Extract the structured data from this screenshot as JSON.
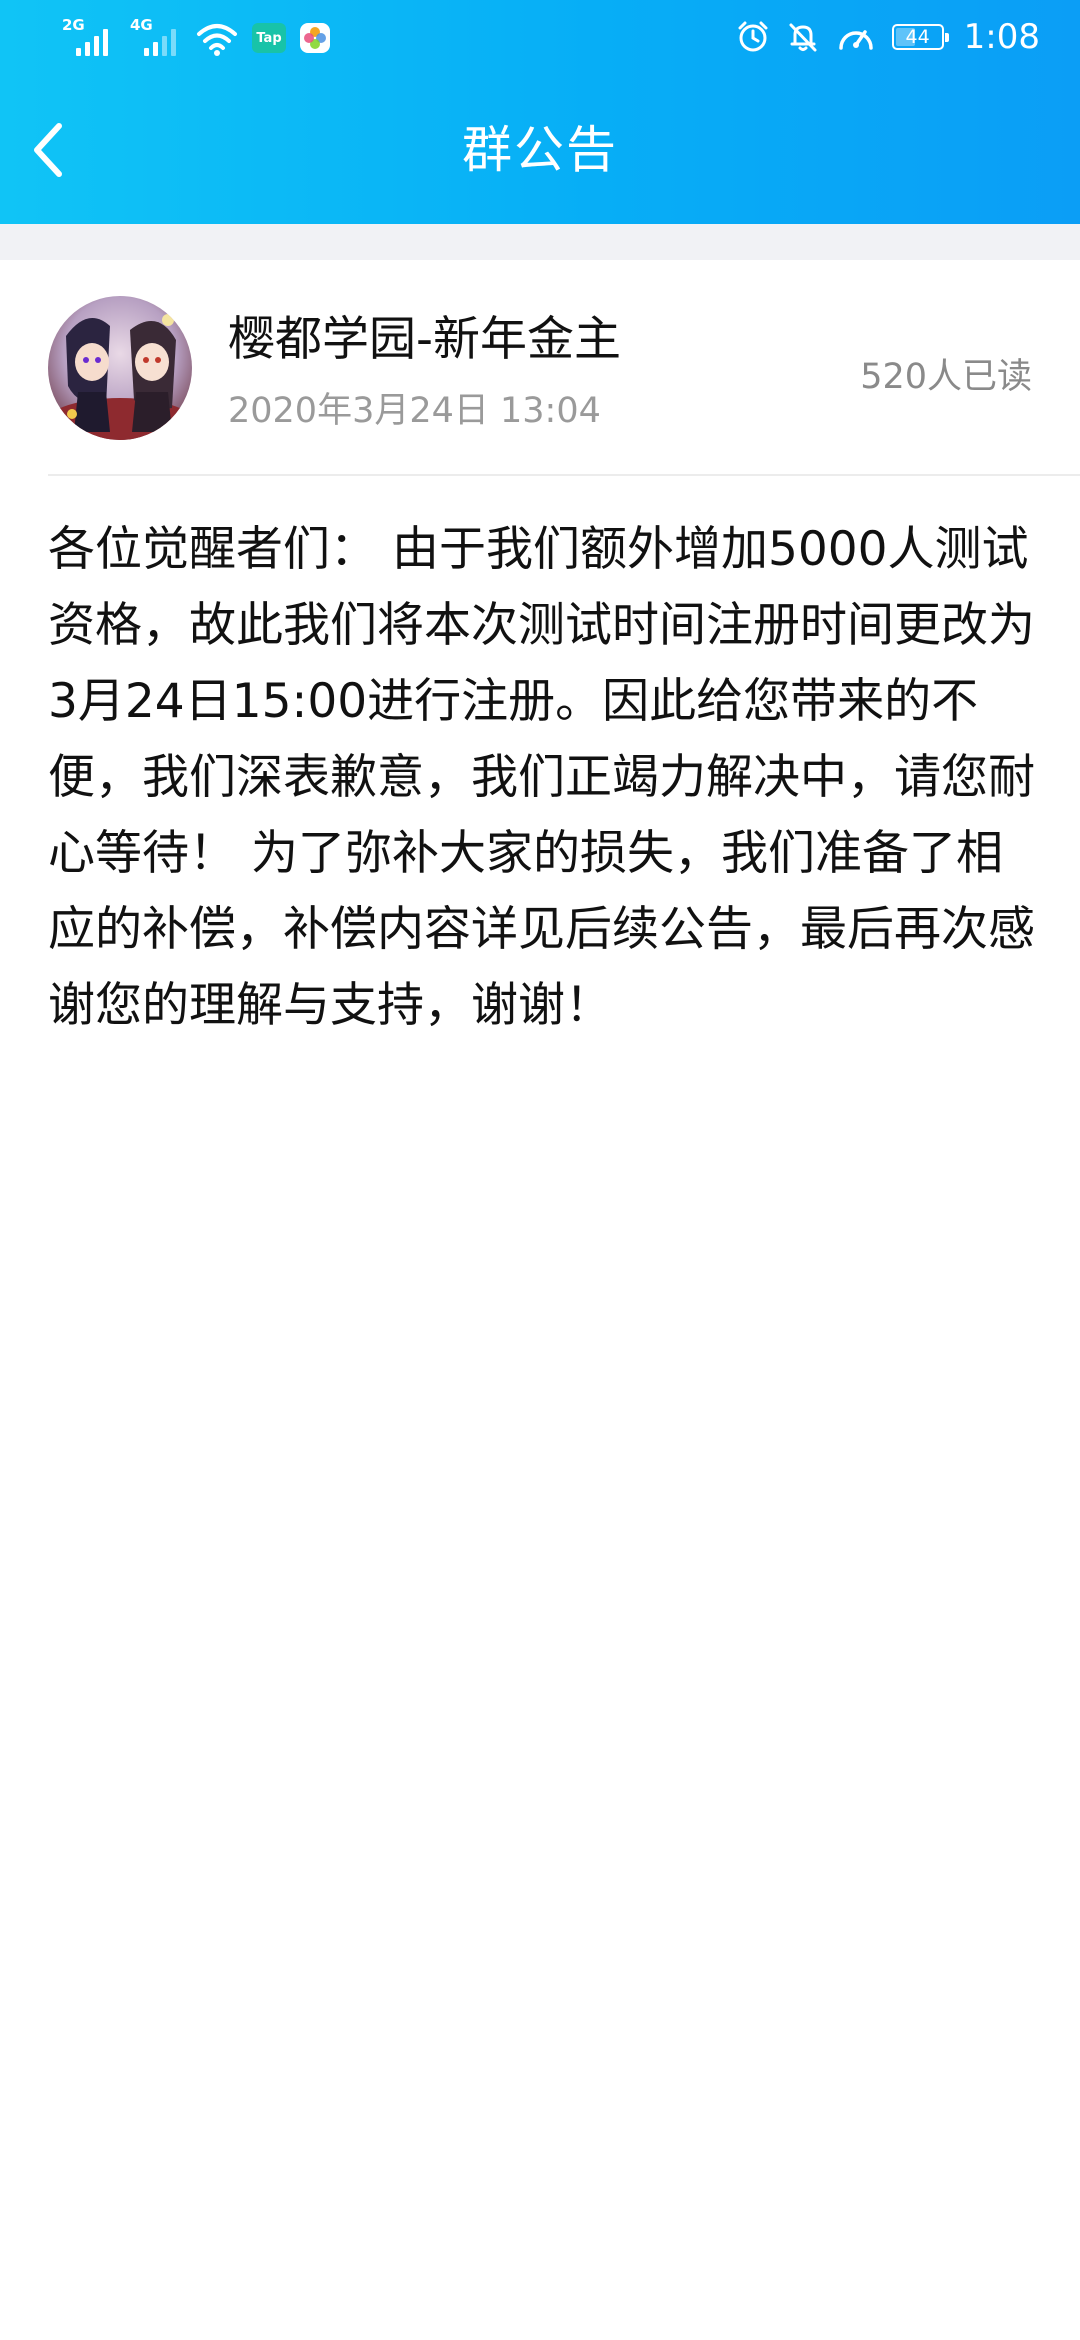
{
  "status_bar": {
    "sim1_type": "2G",
    "sim2_type": "4G",
    "tap_label": "Tap",
    "battery_level": "44",
    "time": "1:08"
  },
  "header": {
    "title": "群公告"
  },
  "announcement": {
    "author_name": "樱都学园-新年金主",
    "timestamp": "2020年3月24日 13:04",
    "read_count": "520人已读",
    "content": "各位觉醒者们： 由于我们额外增加5000人测试资格，故此我们将本次测试时间注册时间更改为3月24日15:00进行注册。因此给您带来的不便，我们深表歉意，我们正竭力解决中，请您耐心等待！ 为了弥补大家的损失，我们准备了相应的补偿，补偿内容详见后续公告，最后再次感谢您的理解与支持，谢谢！"
  },
  "icons": [
    "back-arrow-icon",
    "signal-icon",
    "wifi-icon",
    "tap-app-icon",
    "photos-app-icon",
    "alarm-icon",
    "mute-bell-icon",
    "speed-gauge-icon",
    "battery-icon"
  ],
  "colors": {
    "header_gradient_start": "#10c4f6",
    "header_gradient_end": "#0b9ef6",
    "text_primary": "#111111",
    "text_secondary": "#9a9a9a"
  }
}
